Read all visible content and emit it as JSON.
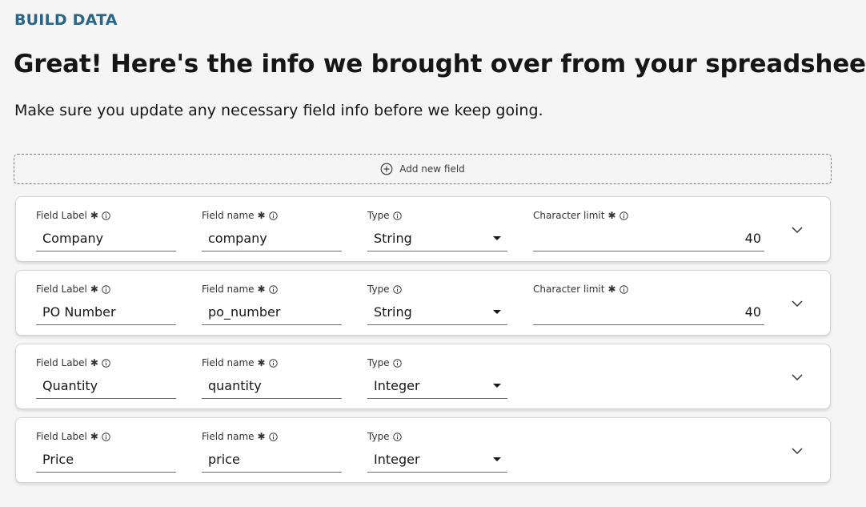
{
  "header": {
    "eyebrow": "BUILD DATA",
    "title": "Great! Here's the info we brought over from your spreadsheet",
    "subtitle": "Make sure you update any necessary field info before we keep going."
  },
  "add_field": {
    "label": "Add new field",
    "icon": "plus-circle-icon"
  },
  "labels": {
    "field_label": "Field Label",
    "field_name": "Field name",
    "type": "Type",
    "char_limit": "Character limit"
  },
  "fields": [
    {
      "label": "Company",
      "name": "company",
      "type": "String",
      "char_limit": "40"
    },
    {
      "label": "PO Number",
      "name": "po_number",
      "type": "String",
      "char_limit": "40"
    },
    {
      "label": "Quantity",
      "name": "quantity",
      "type": "Integer"
    },
    {
      "label": "Price",
      "name": "price",
      "type": "Integer"
    }
  ],
  "colors": {
    "accent": "#2b6585",
    "background": "#f4f5f4",
    "card": "#ffffff"
  }
}
